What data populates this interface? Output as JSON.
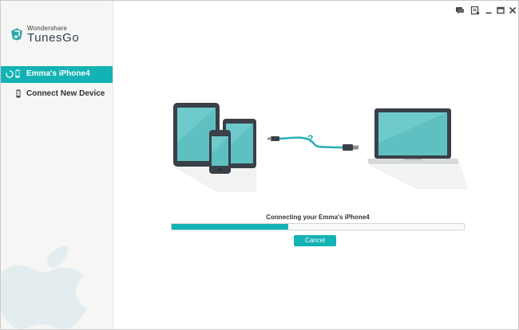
{
  "app": {
    "brand_small": "Wondershare",
    "brand_name": "TunesGo"
  },
  "sidebar": {
    "items": [
      {
        "label": "Emma's iPhone4",
        "active": true,
        "icon": "iphone-icon"
      },
      {
        "label": "Connect New Device",
        "active": false,
        "icon": "iphone-icon"
      }
    ]
  },
  "titlebar": {
    "icons": [
      "feedback-icon",
      "menu-icon",
      "minimize-icon",
      "maximize-icon",
      "close-icon"
    ]
  },
  "main": {
    "status_text": "Connecting your Emma's iPhone4",
    "progress": 0.4,
    "cancel_label": "Cancel"
  },
  "colors": {
    "accent": "#13b2b4",
    "device_dark": "#3a4048",
    "screen": "#5fc0c2"
  }
}
